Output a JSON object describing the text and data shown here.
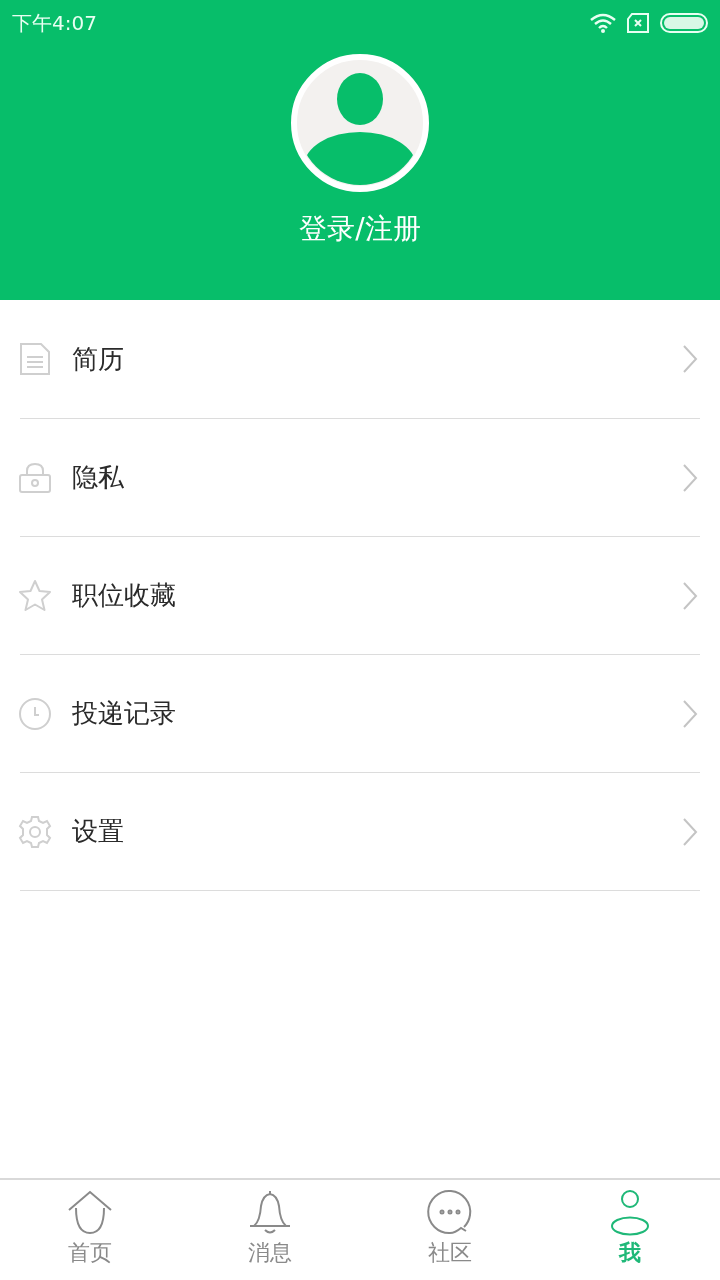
{
  "status_bar": {
    "time": "下午4:07"
  },
  "profile": {
    "login_label": "登录/注册"
  },
  "menu": [
    {
      "kind": "document",
      "label": "简历"
    },
    {
      "kind": "lock",
      "label": "隐私"
    },
    {
      "kind": "star",
      "label": "职位收藏"
    },
    {
      "kind": "clock",
      "label": "投递记录"
    },
    {
      "kind": "gear",
      "label": "设置"
    }
  ],
  "tab_bar": [
    {
      "kind": "home",
      "label": "首页",
      "selected": false
    },
    {
      "kind": "bell",
      "label": "消息",
      "selected": false
    },
    {
      "kind": "chat",
      "label": "社区",
      "selected": false
    },
    {
      "kind": "person",
      "label": "我",
      "selected": true
    }
  ]
}
